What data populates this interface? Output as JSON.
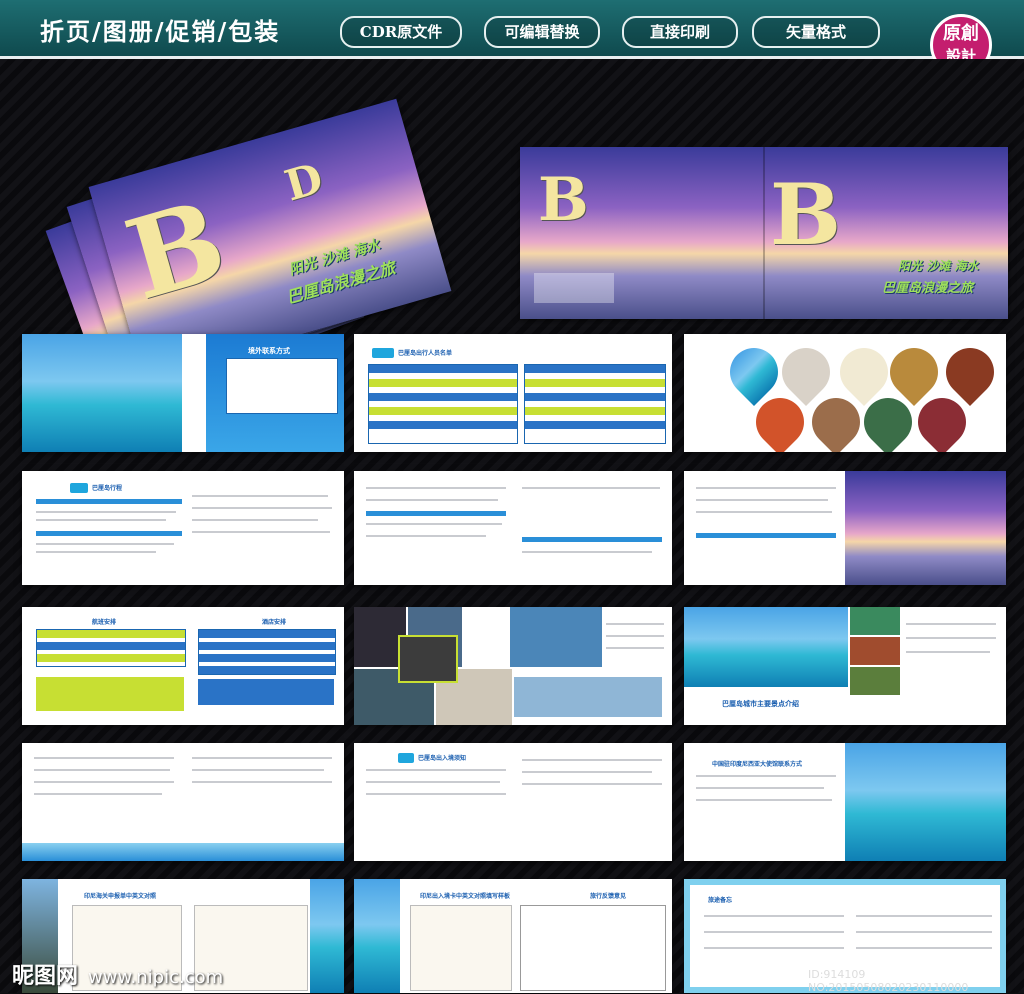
{
  "header": {
    "title": "折页/图册/促销/包装",
    "tags": [
      "CDR原文件",
      "可编辑替换",
      "直接印刷",
      "矢量格式"
    ],
    "badge_line1": "原創",
    "badge_line2": "設計"
  },
  "cover": {
    "slogan_line1": "阳光 沙滩 海水",
    "slogan_line2": "巴厘岛浪漫之旅"
  },
  "pages": {
    "contacts_title": "境外联系方式",
    "travel_list_title": "巴厘岛出行人员名单",
    "itinerary_title": "巴厘岛行程",
    "flight_title": "航班安排",
    "hotel_title": "酒店安排",
    "attractions_title": "巴厘岛城市主要景点介绍",
    "entry_title": "巴厘岛出入境须知",
    "embassy_title": "中国驻印度尼西亚大使馆联系方式",
    "arrival_card_title": "印尼海关申报单中英文对照",
    "entry_card_title": "印尼出入境卡中英文对照填写样板",
    "feedback_title": "旅行反馈意见",
    "notes_title": "旅途备忘"
  },
  "watermark": {
    "site_name": "昵图网",
    "site_url": "www.nipic.com",
    "id_text": "ID:914109 NO:20150508020230110000"
  }
}
